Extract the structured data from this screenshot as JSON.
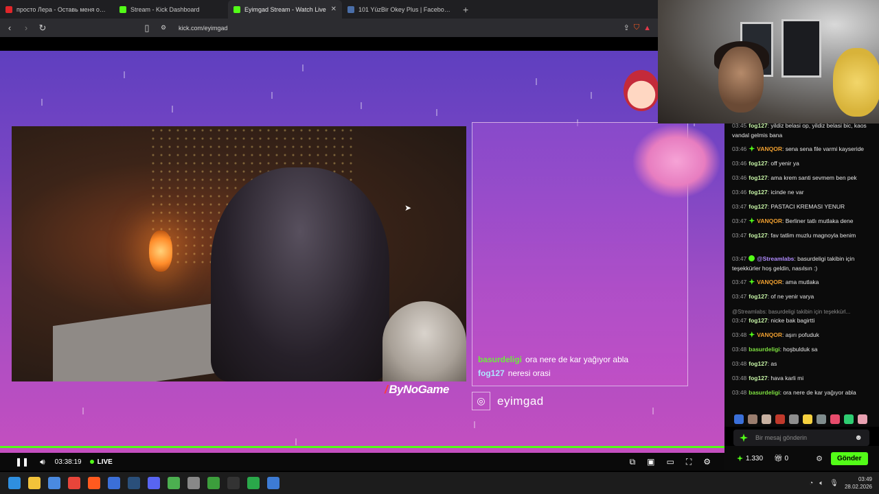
{
  "browser": {
    "tabs": [
      {
        "label": "просто Лера - Оставь меня одн...",
        "favicon_color": "#e0262a",
        "active": false
      },
      {
        "label": "Stream - Kick Dashboard",
        "favicon_color": "#53fc18",
        "active": false
      },
      {
        "label": "Eyimgad Stream - Watch Live",
        "favicon_color": "#53fc18",
        "active": true
      },
      {
        "label": "101 YüzBir Okey Plus | Facebook",
        "favicon_color": "#4a6ea8",
        "active": false
      }
    ],
    "url": "kick.com/eyimgad",
    "icons": [
      "back-icon",
      "forward-icon",
      "reload-icon",
      "bookmark-icon",
      "share-icon",
      "brave-shield-icon",
      "brave-rewards-icon"
    ]
  },
  "stream": {
    "overlay_chat": [
      {
        "user": "basurdeligi",
        "text": "ora nere de kar yağıyor abla"
      },
      {
        "user": "fog127",
        "text": "neresi orasi"
      }
    ],
    "brand": "ByNoGame",
    "instagram_handle": "eyimgad"
  },
  "player": {
    "time": "03:38:19",
    "live_label": "LIVE",
    "accent": "#53fc18"
  },
  "chat": {
    "messages": [
      {
        "time": "03:45",
        "user": "fog127",
        "text": "yildiz belasi op, yildiz belasi bic, kaos vandal gelmis bana",
        "badge": "",
        "ucls": "u-fog"
      },
      {
        "time": "03:46",
        "user": "VANQOR",
        "text": "sena sena file varmi kayseride",
        "badge": "g",
        "ucls": "u-van"
      },
      {
        "time": "03:46",
        "user": "fog127",
        "text": "off yenir ya",
        "badge": "",
        "ucls": "u-fog"
      },
      {
        "time": "03:46",
        "user": "fog127",
        "text": "ama krem santi sevmem ben pek",
        "badge": "",
        "ucls": "u-fog"
      },
      {
        "time": "03:46",
        "user": "fog127",
        "text": "icinde ne var",
        "badge": "",
        "ucls": "u-fog"
      },
      {
        "time": "03:47",
        "user": "fog127",
        "text": "PASTACI KREMASI YENUR",
        "badge": "",
        "ucls": "u-fog"
      },
      {
        "time": "03:47",
        "user": "VANQOR",
        "text": "Berliner tatlı mutlaka dene",
        "badge": "g",
        "ucls": "u-van"
      },
      {
        "time": "03:47",
        "user": "fog127",
        "text": "fav tatlim muzlu magnoyla benim",
        "badge": "",
        "ucls": "u-fog"
      },
      {
        "time": "03:47",
        "user": "@Streamlabs",
        "text": "basurdeligi takibin için teşekkürler hoş geldin, nasılsın :)",
        "badge": "v",
        "ucls": "u-str"
      },
      {
        "time": "03:47",
        "user": "VANQOR",
        "text": "ama mutlaka",
        "badge": "g",
        "ucls": "u-van"
      },
      {
        "time": "03:47",
        "user": "fog127",
        "text": "of ne yenir varya",
        "badge": "",
        "ucls": "u-fog"
      },
      {
        "time": "03:47",
        "user": "fog127",
        "text": "nicke bak bagirtti",
        "badge": "",
        "ucls": "u-fog"
      },
      {
        "time": "03:48",
        "user": "VANQOR",
        "text": "aşırı pofuduk",
        "badge": "g",
        "ucls": "u-van"
      },
      {
        "time": "03:48",
        "user": "basurdeligi",
        "text": "hoşbulduk sa",
        "badge": "",
        "ucls": "u-bas"
      },
      {
        "time": "03:48",
        "user": "fog127",
        "text": "as",
        "badge": "",
        "ucls": "u-fog"
      },
      {
        "time": "03:48",
        "user": "fog127",
        "text": "hava karli mi",
        "badge": "",
        "ucls": "u-fog"
      },
      {
        "time": "03:48",
        "user": "basurdeligi",
        "text": "ora nere de kar yağıyor abla",
        "badge": "",
        "ucls": "u-bas"
      },
      {
        "time": "03:48",
        "user": "fog127",
        "text": "neresi orasi",
        "badge": "",
        "ucls": "u-fog"
      }
    ],
    "reply_preview": "@Streamlabs: basurdeligi takibin için teşekkürl...",
    "input_placeholder": "Bir mesaj gönderin",
    "points": "1.330",
    "gifts": "0",
    "send_label": "Gönder"
  },
  "taskbar": {
    "apps": [
      "windows-start-icon",
      "file-explorer-icon",
      "app-icon",
      "chrome-icon",
      "brave-icon",
      "app-icon",
      "steam-icon",
      "discord-icon",
      "app-icon",
      "app-icon",
      "minecraft-icon",
      "epic-games-icon",
      "xbox-icon",
      "app-icon"
    ],
    "app_colors": [
      "#2f8fe0",
      "#f2c23a",
      "#4a8ae0",
      "#e7453a",
      "#ff5a1f",
      "#3b6fd8",
      "#2a4f7a",
      "#5865f2",
      "#4caf50",
      "#888888",
      "#3c9e3c",
      "#333333",
      "#2aa84a",
      "#3d7bd4"
    ],
    "time": "03:49",
    "date": "28.02.2026"
  }
}
